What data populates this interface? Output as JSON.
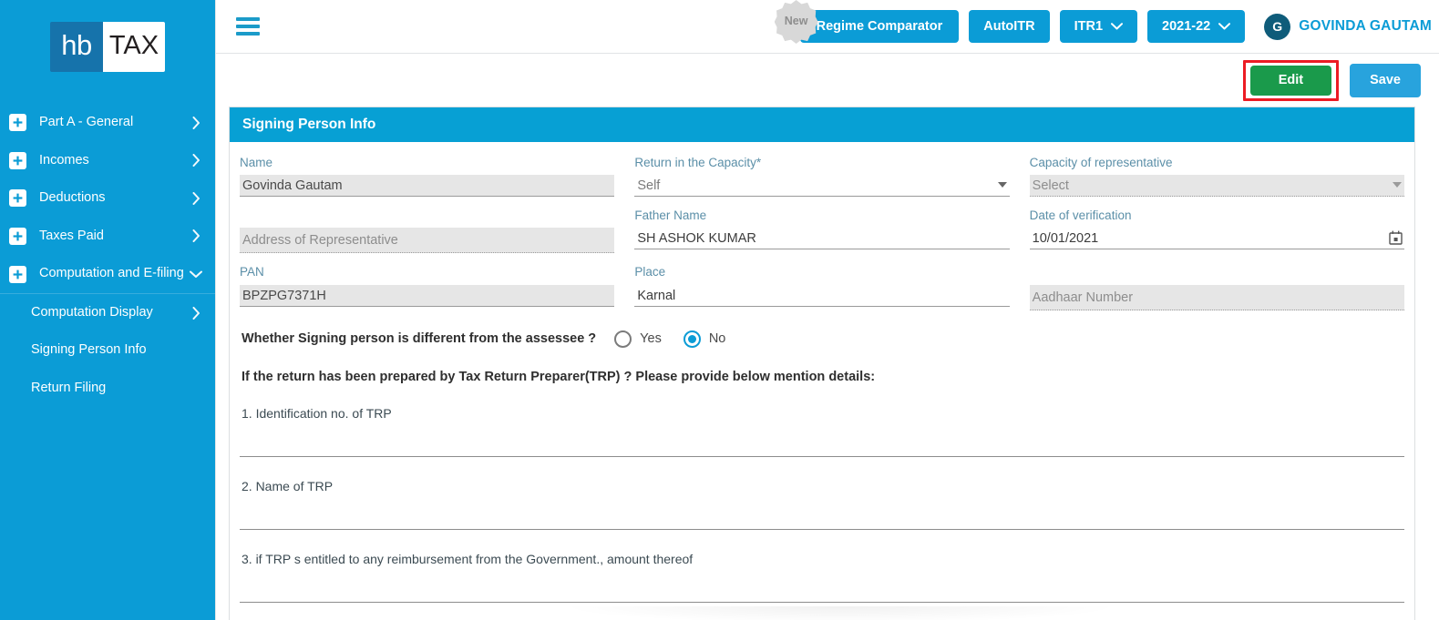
{
  "brand": {
    "logo_left": "hb",
    "logo_right": "TAX"
  },
  "sidebar": {
    "items": [
      {
        "label": "Part A - General",
        "icon": "plus-box-icon",
        "chevron": "chevron-right-icon",
        "level": "top"
      },
      {
        "label": "Incomes",
        "icon": "plus-box-icon",
        "chevron": "chevron-right-icon",
        "level": "top"
      },
      {
        "label": "Deductions",
        "icon": "plus-box-icon",
        "chevron": "chevron-right-icon",
        "level": "top"
      },
      {
        "label": "Taxes Paid",
        "icon": "plus-box-icon",
        "chevron": "chevron-right-icon",
        "level": "top"
      },
      {
        "label": "Computation and E-filing",
        "icon": "plus-box-icon",
        "chevron": "chevron-down-icon",
        "level": "top"
      },
      {
        "label": "Computation Display",
        "chevron": "chevron-right-icon",
        "level": "sub"
      },
      {
        "label": "Signing Person Info",
        "level": "sub"
      },
      {
        "label": "Return Filing",
        "level": "sub"
      }
    ]
  },
  "topbar": {
    "menu_icon": "hamburger-icon",
    "regime_comparator": "Regime Comparator",
    "new_badge": "New",
    "autoitr": "AutoITR",
    "form_type": "ITR1",
    "assessment_year": "2021-22",
    "user_initial": "G",
    "user_name": "GOVINDA GAUTAM"
  },
  "actions": {
    "edit_label": "Edit",
    "save_label": "Save"
  },
  "card": {
    "title": "Signing Person Info",
    "fields": {
      "name": {
        "label": "Name",
        "value": "Govinda  Gautam"
      },
      "return_capacity": {
        "label": "Return in the Capacity",
        "required": "*",
        "value": "Self"
      },
      "capacity_of_rep": {
        "label": "Capacity of representative",
        "value": "Select"
      },
      "address_of_rep": {
        "label": "Address of Representative",
        "value": ""
      },
      "father_name": {
        "label": "Father Name",
        "value": "SH ASHOK KUMAR"
      },
      "date_of_verification": {
        "label": "Date of verification",
        "value": "10/01/2021"
      },
      "pan": {
        "label": "PAN",
        "value": "BPZPG7371H"
      },
      "place": {
        "label": "Place",
        "value": "Karnal"
      },
      "aadhaar": {
        "label": "Aadhaar Number",
        "value": ""
      }
    },
    "signing_question": "Whether Signing person is different from the assessee ?",
    "radio_yes": "Yes",
    "radio_no": "No",
    "trp_heading": "If the return has been prepared by Tax Return Preparer(TRP) ? Please provide below mention details:",
    "trp_items": [
      {
        "text": "1. Identification no. of TRP",
        "value": ""
      },
      {
        "text": "2. Name of TRP",
        "value": ""
      },
      {
        "text": "3. if TRP s entitled to any reimbursement from the Government., amount thereof",
        "value": ""
      }
    ]
  },
  "colors": {
    "brand_blue": "#0b9cd6",
    "panel_blue": "#07a0d4",
    "edit_green": "#1a9a4b",
    "save_blue": "#28a3dd",
    "highlight_red": "#ec1c24",
    "label_blue": "#5b8fa8",
    "avatar_dark": "#0f5c7a"
  }
}
